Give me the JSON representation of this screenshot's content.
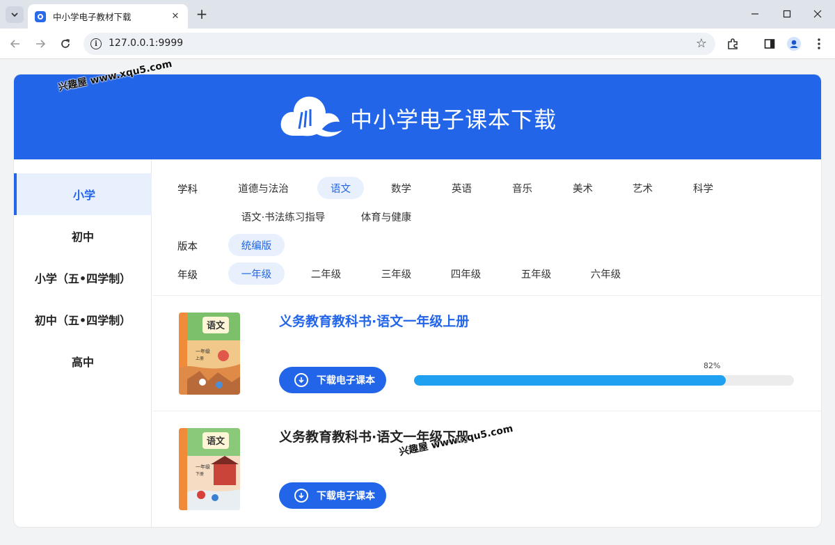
{
  "browser": {
    "tab_title": "中小学电子教材下载",
    "url": "127.0.0.1:9999"
  },
  "banner": {
    "title": "中小学电子课本下载"
  },
  "sidebar": {
    "items": [
      {
        "label": "小学",
        "active": true
      },
      {
        "label": "初中",
        "active": false
      },
      {
        "label": "小学（五•四学制）",
        "active": false
      },
      {
        "label": "初中（五•四学制）",
        "active": false
      },
      {
        "label": "高中",
        "active": false
      }
    ]
  },
  "filters": {
    "subject_label": "学科",
    "subjects": [
      "道德与法治",
      "语文",
      "数学",
      "英语",
      "音乐",
      "美术",
      "艺术",
      "科学",
      "语文·书法练习指导",
      "体育与健康"
    ],
    "subject_selected": "语文",
    "edition_label": "版本",
    "editions": [
      "统编版"
    ],
    "edition_selected": "统编版",
    "grade_label": "年级",
    "grades": [
      "一年级",
      "二年级",
      "三年级",
      "四年级",
      "五年级",
      "六年级"
    ],
    "grade_selected": "一年级"
  },
  "books": [
    {
      "title": "义务教育教科书·语文一年级上册",
      "download_label": "下载电子课本",
      "progress_text": "82%",
      "progress": 0.82,
      "cover_title": "语文",
      "cover_grade": "一年级",
      "cover_term": "上册"
    },
    {
      "title": "义务教育教科书·语文一年级下册",
      "download_label": "下载电子课本",
      "cover_title": "语文",
      "cover_grade": "一年级",
      "cover_term": "下册"
    }
  ],
  "watermarks": [
    "兴趣屋 www.xqu5.com",
    "兴趣屋 www.xqu5.com"
  ],
  "colors": {
    "brand": "#2265e8",
    "progress": "#1fa0f1",
    "selected_bg": "#e8f0fd"
  }
}
